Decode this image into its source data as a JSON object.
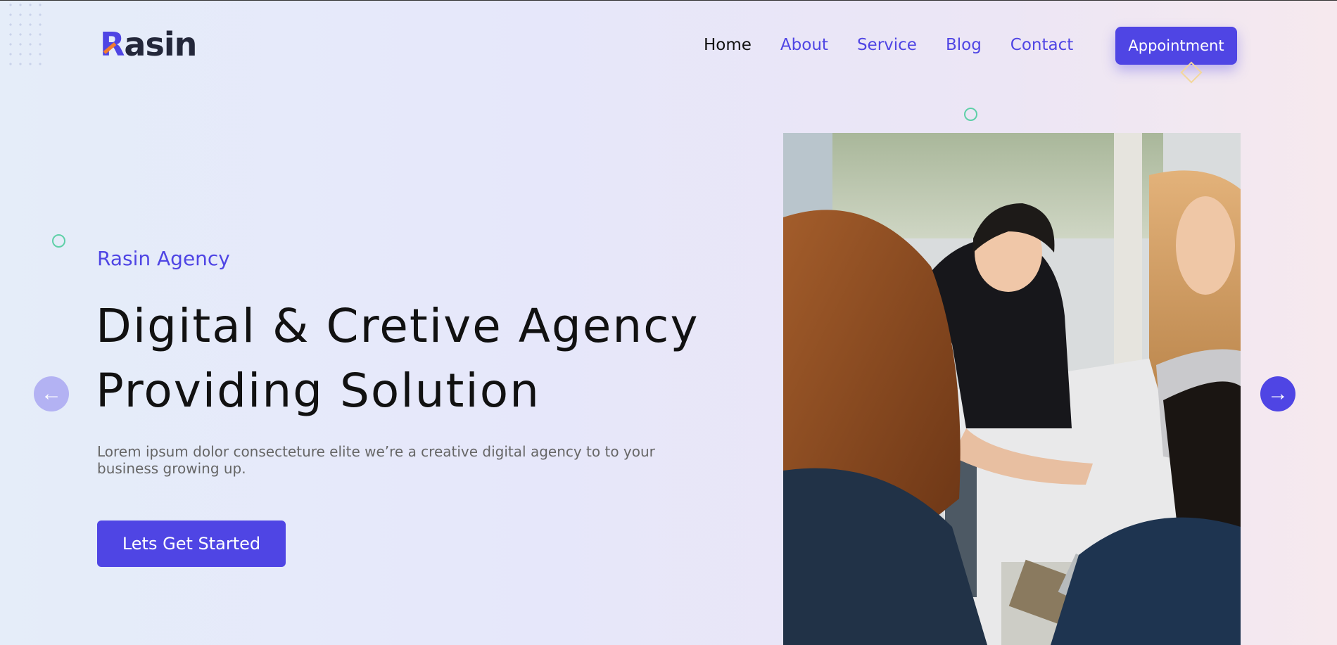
{
  "brand": {
    "logo_first": "R",
    "logo_rest": "asin"
  },
  "nav": {
    "items": [
      {
        "label": "Home",
        "active": true
      },
      {
        "label": "About"
      },
      {
        "label": "Service"
      },
      {
        "label": "Blog"
      },
      {
        "label": "Contact"
      }
    ],
    "appointment_label": "Appointment"
  },
  "hero": {
    "eyebrow": "Rasin Agency",
    "title_line1": "Digital & Cretive Agency",
    "title_line2": "Providing Solution",
    "description": "Lorem ipsum dolor consecteture elite we’re a creative digital agency to to your business growing up.",
    "cta_label": "Lets Get Started",
    "prev_icon": "←",
    "next_icon": "→"
  },
  "colors": {
    "accent": "#4f45e4",
    "logo_mark": "#f47c2c",
    "decor_circle": "#5fd0a8",
    "decor_diamond": "#f3d79a"
  }
}
